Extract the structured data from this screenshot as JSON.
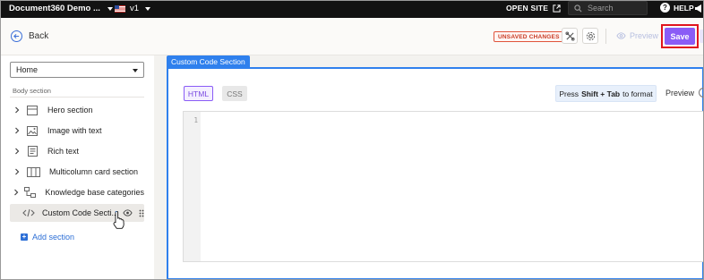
{
  "topbar": {
    "project_name": "Document360 Demo ...",
    "version": "v1",
    "open_site_label": "OPEN SITE",
    "search_placeholder": "Search",
    "help_label": "HELP"
  },
  "header": {
    "back_label": "Back",
    "unsaved_label": "UNSAVED CHANGES",
    "preview_label": "Preview",
    "save_label": "Save"
  },
  "sidebar": {
    "page_select_value": "Home",
    "section_label": "Body section",
    "items": [
      {
        "label": "Hero section",
        "icon": "layout-rows-icon"
      },
      {
        "label": "Image with text",
        "icon": "image-icon"
      },
      {
        "label": "Rich text",
        "icon": "document-icon"
      },
      {
        "label": "Multicolumn card section",
        "icon": "columns-icon"
      },
      {
        "label": "Knowledge base categories",
        "icon": "hierarchy-icon"
      },
      {
        "label": "Custom Code Secti...",
        "icon": "code-icon",
        "selected": true
      }
    ],
    "add_section_label": "Add section"
  },
  "editor": {
    "panel_title": "Custom Code Section",
    "tab_html": "HTML",
    "tab_css": "CSS",
    "format_hint_prefix": "Press",
    "format_hint_keys": "Shift + Tab",
    "format_hint_suffix": "to format",
    "preview_label": "Preview",
    "line_number": "1"
  },
  "colors": {
    "accent_purple": "#8a5cf6",
    "accent_blue": "#2f80ed",
    "highlight_red": "#e0141e",
    "topbar_bg": "#121212"
  }
}
